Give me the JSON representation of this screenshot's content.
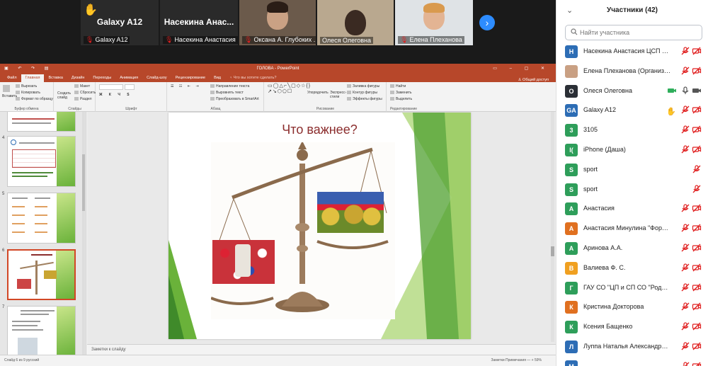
{
  "video_tiles": [
    {
      "big_name": "Galaxy A12",
      "caption": "Galaxy A12",
      "raised_hand": true
    },
    {
      "big_name": "Насекина  Анас...",
      "caption": "Насекина Анастасия ..."
    },
    {
      "caption": "Оксана А. Глубоких ..."
    },
    {
      "caption": "Олеся Олеговна"
    },
    {
      "caption": "Елена Плеханова"
    }
  ],
  "ppt": {
    "window_title": "ГОЛОВА - PowerPoint",
    "tabs": [
      "Файл",
      "Главная",
      "Вставка",
      "Дизайн",
      "Переходы",
      "Анимация",
      "Слайд-шоу",
      "Рецензирование",
      "Вид"
    ],
    "tell_me": "Что вы хотите сделать?",
    "share": "Общий доступ",
    "ribbon": {
      "paste": "Вставить",
      "cut": "Вырезать",
      "copy": "Копировать",
      "format_painter": "Формат по образцу",
      "clipboard_group": "Буфер обмена",
      "new_slide": "Создать слайд",
      "layout": "Макет",
      "reset": "Сбросить",
      "section": "Раздел",
      "slides_group": "Слайды",
      "font_group": "Шрифт",
      "paragraph_group": "Абзац",
      "text_direction": "Направление текста",
      "align_text": "Выровнять текст",
      "smartart": "Преобразовать в SmartArt",
      "arrange": "Упорядочить",
      "quick_styles": "Экспресс-стили",
      "shape_fill": "Заливка фигуры",
      "shape_outline": "Контур фигуры",
      "shape_effects": "Эффекты фигуры",
      "drawing_group": "Рисование",
      "find": "Найти",
      "replace": "Заменить",
      "select": "Выделить",
      "editing_group": "Редактирование"
    },
    "thumb_numbers": [
      "4",
      "5",
      "6",
      "7"
    ],
    "slide_title": "Что важнее?",
    "notes_placeholder": "Заметки к слайду",
    "status_left": "Слайд 6 из 9    русский",
    "status_right": "Заметки    Примечания    —   +  59%"
  },
  "panel": {
    "title": "Участники (42)",
    "search_placeholder": "Найти участника",
    "participants": [
      {
        "initial": "Н",
        "name": "Насекина Анастасия ЦСП Я... (Я)",
        "color": "#2d6db5"
      },
      {
        "initial": "",
        "name": "Елена Плеханова (Организатор)",
        "color": "#c9a083"
      },
      {
        "initial": "О",
        "name": "Олеся Олеговна",
        "color": "#2b2f36",
        "video_on": true
      },
      {
        "initial": "GA",
        "name": "Galaxy A12",
        "color": "#2d6db5",
        "raised_hand": true
      },
      {
        "initial": "3",
        "name": "3105",
        "color": "#2e9e5a"
      },
      {
        "initial": "I(",
        "name": "iPhone (Даша)",
        "color": "#2e9e5a"
      },
      {
        "initial": "S",
        "name": "sport",
        "color": "#2e9e5a",
        "mic_only": true
      },
      {
        "initial": "S",
        "name": "sport",
        "color": "#2e9e5a",
        "mic_only": true
      },
      {
        "initial": "А",
        "name": "Анастасия",
        "color": "#2e9e5a"
      },
      {
        "initial": "А",
        "name": "Анастасия Минулина \"Фортуна\"...",
        "color": "#e07020"
      },
      {
        "initial": "А",
        "name": "Аринова А.А.",
        "color": "#2e9e5a"
      },
      {
        "initial": "В",
        "name": "Валиева Ф. С.",
        "color": "#f0a020"
      },
      {
        "initial": "Г",
        "name": "ГАУ СО \"ЦП и СП СО \"Родник\" ...",
        "color": "#2e9e5a"
      },
      {
        "initial": "К",
        "name": "Кристина Докторова",
        "color": "#e07020"
      },
      {
        "initial": "К",
        "name": "Ксения Бащенко",
        "color": "#2e9e5a"
      },
      {
        "initial": "Л",
        "name": "Луппа Наталья Александровна",
        "color": "#2d6db5"
      },
      {
        "initial": "М",
        "name": "",
        "color": "#2d6db5"
      }
    ]
  },
  "colors": {
    "ppt_accent": "#b7472a",
    "mic_muted": "#e02020",
    "zoom_blue": "#2d8cff"
  }
}
